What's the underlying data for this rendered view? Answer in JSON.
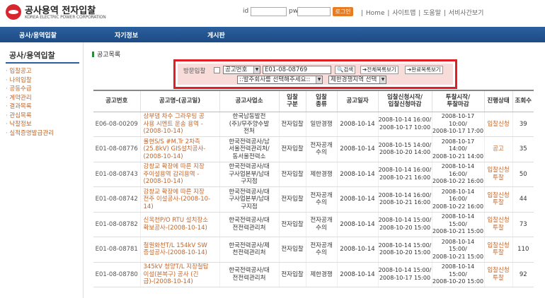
{
  "header": {
    "logo_title": "공사용역 전자입찰",
    "logo_subtitle": "KOREA ELECTRIC POWER CORPORATION",
    "id_label": "id",
    "pw_label": "pw",
    "login_label": "로그인",
    "links": [
      "Home",
      "사이트맵",
      "도움말",
      "서비사간보기"
    ]
  },
  "nav": {
    "items": [
      "공사/용역입찰",
      "자기정보",
      "게시판"
    ]
  },
  "sidebar": {
    "title": "공사/용역입찰",
    "items": [
      "입찰공고",
      "나의입찰",
      "공동수급",
      "계약관리",
      "결과목록",
      "관심목록",
      "낙찰정보",
      "실적증명발급관리"
    ]
  },
  "main": {
    "title": "공고목록"
  },
  "search": {
    "visit_label": "방문입찰",
    "field_select": "공고번호",
    "query_value": "E01-08-08769",
    "search_btn": "검색",
    "all_btn": "전체목록보기",
    "done_btn": "완료목록보기",
    "agency_select": "::발주회사를 선택해주세요::",
    "region_select": "제한경쟁지역 선택"
  },
  "table": {
    "headers": [
      [
        "공고번호"
      ],
      [
        "공고명-(공고일)"
      ],
      [
        "공고사업소"
      ],
      [
        "입찰",
        "구분"
      ],
      [
        "입찰",
        "종류"
      ],
      [
        "공고일자"
      ],
      [
        "입찰신청시작/",
        "입찰신청마감"
      ],
      [
        "투찰시작/",
        "투찰마감"
      ],
      [
        "진행상태"
      ],
      [
        "조회수"
      ]
    ],
    "rows": [
      {
        "no": "E06-08-00209",
        "title": [
          "상부댐 차수 그라우팅 공",
          "사용 시멘트 운송 용역 -",
          "(2008-10-14)"
        ],
        "office": [
          "한국남동발전",
          "(주)/무주양수발",
          "전처"
        ],
        "bid_type": [
          "전자입찰"
        ],
        "bid_kind": [
          "일반경쟁"
        ],
        "date": "2008-10-14",
        "apply": [
          "2008-10-14 16:00/",
          "2008-10-17 10:00"
        ],
        "tender": [
          "2008-10-17 10:00/",
          "2008-10-17 17:00"
        ],
        "status": [
          "입찰신청"
        ],
        "views": "39"
      },
      {
        "no": "E01-08-08776",
        "title": [
          "율현S/S #M.Tr 2차측",
          "(25.8kV) GIS설치공사-",
          "(2008-10-14)"
        ],
        "office": [
          "한국전력공사/남",
          "서울전력관리처/",
          "동서울전력소"
        ],
        "bid_type": [
          "전자입찰"
        ],
        "bid_kind": [
          "전자공개",
          "수의"
        ],
        "date": "2008-10-14",
        "apply": [
          "2008-10-15 14:00/",
          "2008-10-20 14:00"
        ],
        "tender": [
          "2008-10-17 14:00/",
          "2008-10-21 14:00"
        ],
        "status": [
          "공고"
        ],
        "views": "35"
      },
      {
        "no": "E01-08-08743",
        "title": [
          "강창교 확장에 따른 지장",
          "주이설용역 감리용역 -",
          "(2008-10-14)"
        ],
        "office": [
          "한국전력공사/대",
          "구사업본부/남대",
          "구지점"
        ],
        "bid_type": [
          "전자입찰"
        ],
        "bid_kind": [
          "제한경쟁"
        ],
        "date": "2008-10-14",
        "apply": [
          "2008-10-14 16:00/",
          "2008-10-21 16:00"
        ],
        "tender": [
          "2008-10-14 16:00/",
          "2008-10-22 16:00"
        ],
        "status": [
          "입찰신청",
          "투찰"
        ],
        "views": "50"
      },
      {
        "no": "E01-08-08742",
        "title": [
          "강창교 확장에 따른 지장",
          "전주 이설공사-(2008-10-",
          "14)"
        ],
        "office": [
          "한국전력공사/대",
          "구사업본부/남대",
          "구지점"
        ],
        "bid_type": [
          "전자입찰"
        ],
        "bid_kind": [
          "전자공개",
          "수의"
        ],
        "date": "2008-10-14",
        "apply": [
          "2008-10-14 16:00/",
          "2008-10-21 16:00"
        ],
        "tender": [
          "2008-10-14 16:00/",
          "2008-10-22 16:00"
        ],
        "status": [
          "입찰신청",
          "투찰"
        ],
        "views": "44"
      },
      {
        "no": "E01-08-08782",
        "title": [
          "신옥천P/O RTU 설치장소",
          "확보공사-(2008-10-14)"
        ],
        "office": [
          "한국전력공사/대",
          "전전력관리처"
        ],
        "bid_type": [
          "전자입찰"
        ],
        "bid_kind": [
          "전자공개",
          "수의"
        ],
        "date": "2008-10-14",
        "apply": [
          "2008-10-14 15:00/",
          "2008-10-20 15:00"
        ],
        "tender": [
          "2008-10-14 15:00/",
          "2008-10-21 15:00"
        ],
        "status": [
          "입찰신청",
          "투찰"
        ],
        "views": "73"
      },
      {
        "no": "E01-08-08781",
        "title": [
          "철원화천T/L 154kV SW",
          "증설공사-(2008-10-14)"
        ],
        "office": [
          "한국전력공사/제",
          "천전력관리처"
        ],
        "bid_type": [
          "전자입찰"
        ],
        "bid_kind": [
          "전자공개",
          "수의"
        ],
        "date": "2008-10-14",
        "apply": [
          "2008-10-14 15:00/",
          "2008-10-20 15:00"
        ],
        "tender": [
          "2008-10-14 15:00/",
          "2008-10-21 15:00"
        ],
        "status": [
          "입찰신청",
          "투찰"
        ],
        "views": "110"
      },
      {
        "no": "E01-08-08780",
        "title": [
          "345kV 청양T/L 지장철탑",
          "이설(본복구) 공사 (긴",
          "급)-(2008-10-14)"
        ],
        "office": [
          "한국전력공사/대",
          "전전력관리처"
        ],
        "bid_type": [
          "전자입찰"
        ],
        "bid_kind": [
          "제한경쟁"
        ],
        "date": "2008-10-14",
        "apply": [
          "2008-10-14 15:00/",
          "2008-10-17 15:00"
        ],
        "tender": [
          "2008-10-14 15:00/",
          "2008-10-20 15:00"
        ],
        "status": [
          "입찰신청",
          "투찰"
        ],
        "views": "92"
      }
    ]
  }
}
